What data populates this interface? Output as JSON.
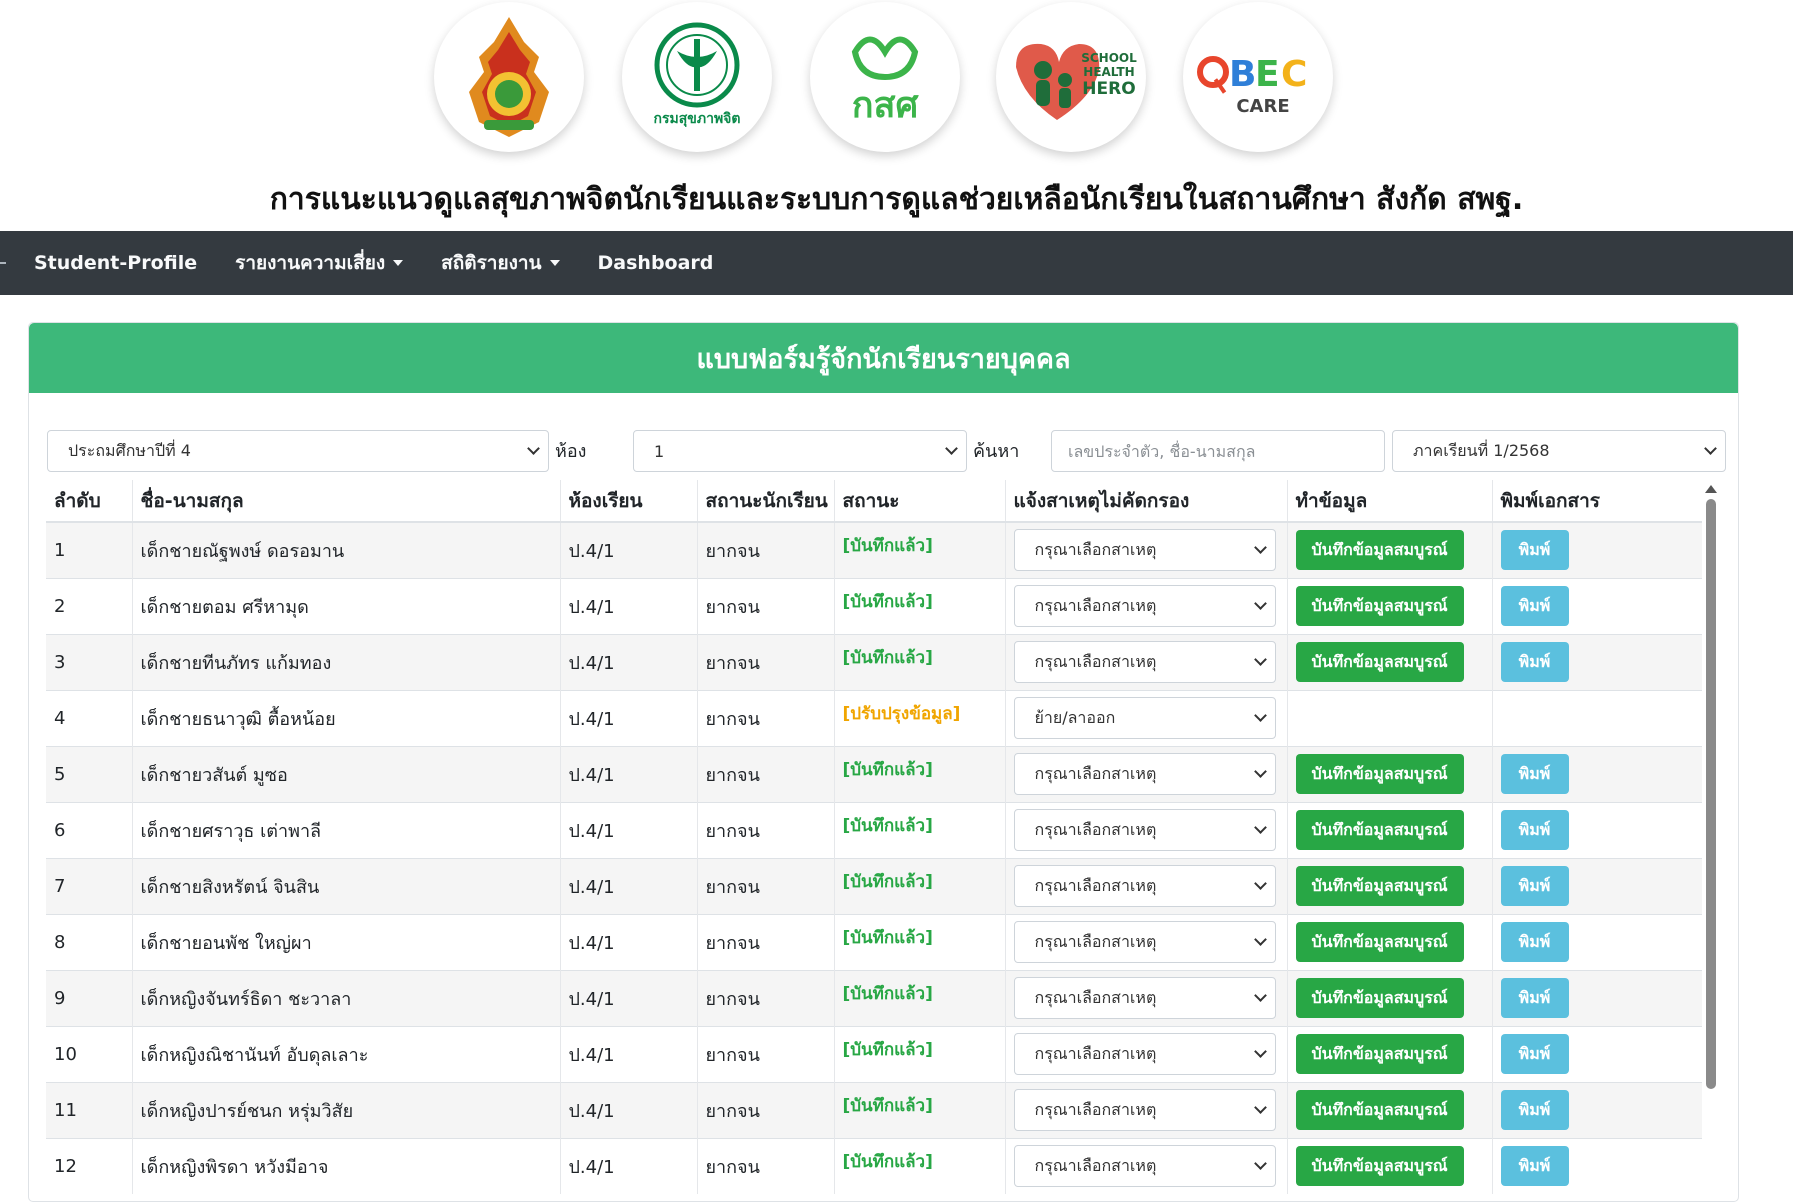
{
  "logos": [
    {
      "name": "obec-emblem-logo",
      "color": "#e08a1e"
    },
    {
      "name": "department-of-mental-health-logo",
      "color": "#0a8a4a",
      "text": "กรมสุขภาพจิต"
    },
    {
      "name": "thaihealth-logo",
      "color": "#3cb44a",
      "text": "กสศ"
    },
    {
      "name": "school-health-hero-logo",
      "color": "#e05a4a",
      "text": "SCHOOL HEALTH HERO"
    },
    {
      "name": "obec-care-logo",
      "color": "#2f7fd8",
      "text": "OBEC",
      "subtext": "CARE"
    }
  ],
  "header": {
    "title": "การแนะแนวดูแลสุขภาพจิตนักเรียนและระบบการดูแลช่วยเหลือนักเรียนในสถานศึกษา สังกัด สพฐ."
  },
  "nav": {
    "items": [
      {
        "label": "Student-Profile",
        "dropdown": false
      },
      {
        "label": "รายงานความเสี่ยง",
        "dropdown": true
      },
      {
        "label": "สถิติรายงาน",
        "dropdown": true
      },
      {
        "label": "Dashboard",
        "dropdown": false
      }
    ]
  },
  "card": {
    "title": "แบบฟอร์มรู้จักนักเรียนรายบุคคล"
  },
  "filters": {
    "grade_value": "ประถมศึกษาปีที่ 4",
    "room_label": "ห้อง",
    "room_value": "1",
    "search_label": "ค้นหา",
    "search_placeholder": "เลขประจำตัว, ชื่อ-นามสกุล",
    "term_value": "ภาคเรียนที่ 1/2568"
  },
  "table": {
    "headers": [
      "ลำดับ",
      "ชื่อ-นามสกุล",
      "ห้องเรียน",
      "สถานะนักเรียน",
      "สถานะ",
      "แจ้งสาเหตุไม่คัดกรอง",
      "ทำข้อมูล",
      "พิมพ์เอกสาร"
    ],
    "save_label": "บันทึกข้อมูลสมบูรณ์",
    "print_label": "พิมพ์",
    "rows": [
      {
        "no": "1",
        "name": "เด็กชายณัฐพงษ์ ดอรอมาน",
        "room": "ป.4/1",
        "student_status": "ยากจน",
        "status": "[บันทึกแล้ว]",
        "status_type": "saved",
        "reason": "กรุณาเลือกสาเหตุ",
        "actions": true
      },
      {
        "no": "2",
        "name": "เด็กชายตอม ศรีหามุด",
        "room": "ป.4/1",
        "student_status": "ยากจน",
        "status": "[บันทึกแล้ว]",
        "status_type": "saved",
        "reason": "กรุณาเลือกสาเหตุ",
        "actions": true
      },
      {
        "no": "3",
        "name": "เด็กชายทีนภัทร แก้มทอง",
        "room": "ป.4/1",
        "student_status": "ยากจน",
        "status": "[บันทึกแล้ว]",
        "status_type": "saved",
        "reason": "กรุณาเลือกสาเหตุ",
        "actions": true
      },
      {
        "no": "4",
        "name": "เด็กชายธนาวุฒิ ตื้อหน้อย",
        "room": "ป.4/1",
        "student_status": "ยากจน",
        "status": "[ปรับปรุงข้อมูล]",
        "status_type": "update",
        "reason": "ย้าย/ลาออก",
        "actions": false
      },
      {
        "no": "5",
        "name": "เด็กชายวสันต์ มูซอ",
        "room": "ป.4/1",
        "student_status": "ยากจน",
        "status": "[บันทึกแล้ว]",
        "status_type": "saved",
        "reason": "กรุณาเลือกสาเหตุ",
        "actions": true
      },
      {
        "no": "6",
        "name": "เด็กชายศราวุธ เต่าพาลี",
        "room": "ป.4/1",
        "student_status": "ยากจน",
        "status": "[บันทึกแล้ว]",
        "status_type": "saved",
        "reason": "กรุณาเลือกสาเหตุ",
        "actions": true
      },
      {
        "no": "7",
        "name": "เด็กชายสิงหรัตน์ จินสิน",
        "room": "ป.4/1",
        "student_status": "ยากจน",
        "status": "[บันทึกแล้ว]",
        "status_type": "saved",
        "reason": "กรุณาเลือกสาเหตุ",
        "actions": true
      },
      {
        "no": "8",
        "name": "เด็กชายอนพัช ใหญ่ผา",
        "room": "ป.4/1",
        "student_status": "ยากจน",
        "status": "[บันทึกแล้ว]",
        "status_type": "saved",
        "reason": "กรุณาเลือกสาเหตุ",
        "actions": true
      },
      {
        "no": "9",
        "name": "เด็กหญิงจันทร์ธิดา ชะวาลา",
        "room": "ป.4/1",
        "student_status": "ยากจน",
        "status": "[บันทึกแล้ว]",
        "status_type": "saved",
        "reason": "กรุณาเลือกสาเหตุ",
        "actions": true
      },
      {
        "no": "10",
        "name": "เด็กหญิงณิชานันท์ อับดุลเลาะ",
        "room": "ป.4/1",
        "student_status": "ยากจน",
        "status": "[บันทึกแล้ว]",
        "status_type": "saved",
        "reason": "กรุณาเลือกสาเหตุ",
        "actions": true
      },
      {
        "no": "11",
        "name": "เด็กหญิงปารย์ชนก หรุ่มวิสัย",
        "room": "ป.4/1",
        "student_status": "ยากจน",
        "status": "[บันทึกแล้ว]",
        "status_type": "saved",
        "reason": "กรุณาเลือกสาเหตุ",
        "actions": true
      },
      {
        "no": "12",
        "name": "เด็กหญิงพิรดา หวังมีอาจ",
        "room": "ป.4/1",
        "student_status": "ยากจน",
        "status": "[บันทึกแล้ว]",
        "status_type": "saved",
        "reason": "กรุณาเลือกสาเหตุ",
        "actions": true
      }
    ]
  }
}
